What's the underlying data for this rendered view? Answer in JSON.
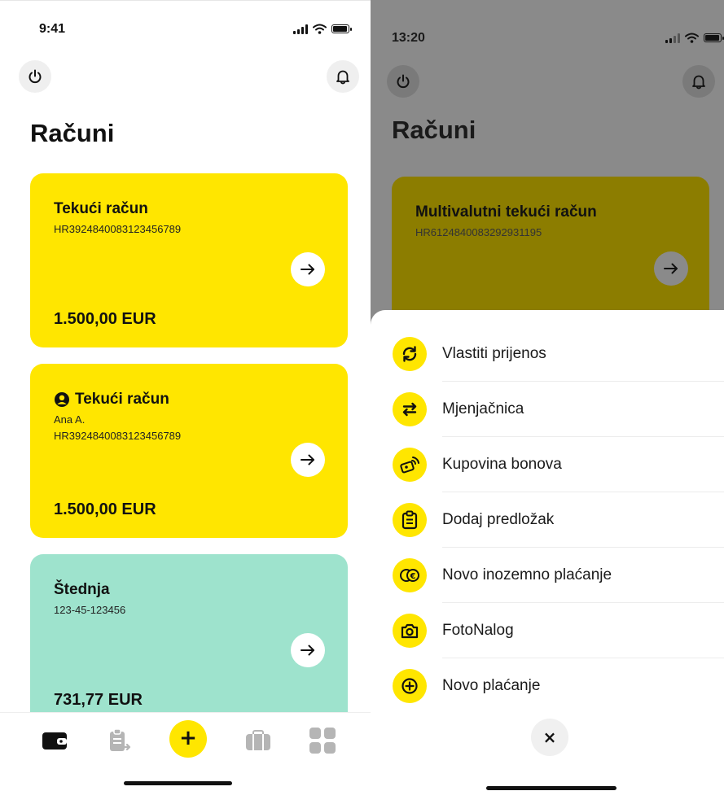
{
  "left_screen": {
    "status": {
      "time": "9:41"
    },
    "title": "Računi",
    "accounts": [
      {
        "name": "Tekući račun",
        "holder": "",
        "iban": "HR3924840083123456789",
        "balance": "1.500,00 EUR"
      },
      {
        "name": "Tekući račun",
        "holder": "Ana A.",
        "iban": "HR3924840083123456789",
        "balance": "1.500,00 EUR"
      },
      {
        "name": "Štednja",
        "holder": "",
        "iban": "123-45-123456",
        "balance": "731,77 EUR"
      }
    ],
    "tabbar": {
      "icons": [
        "wallet-icon",
        "clipboard-icon",
        "plus-icon",
        "briefcase-icon",
        "grid-icon"
      ],
      "plus_label": "+"
    }
  },
  "right_screen": {
    "status": {
      "time": "13:20"
    },
    "title": "Računi",
    "background_account": {
      "name": "Multivalutni tekući račun",
      "iban": "HR6124840083292931195"
    },
    "menu": {
      "items": [
        {
          "label": "Vlastiti prijenos",
          "icon": "refresh-icon"
        },
        {
          "label": "Mjenjačnica",
          "icon": "exchange-icon"
        },
        {
          "label": "Kupovina bonova",
          "icon": "voucher-icon"
        },
        {
          "label": "Dodaj predložak",
          "icon": "template-icon"
        },
        {
          "label": "Novo inozemno plaćanje",
          "icon": "currency-icon"
        },
        {
          "label": "FotoNalog",
          "icon": "camera-icon"
        },
        {
          "label": "Novo plaćanje",
          "icon": "plus-circle-icon"
        }
      ],
      "close_label": "×"
    }
  },
  "colors": {
    "accent_yellow": "#ffe600",
    "savings_mint": "#9ee3cd",
    "overlay_gray": "#8a8a8a",
    "dimmed_card": "#8c7d00"
  }
}
